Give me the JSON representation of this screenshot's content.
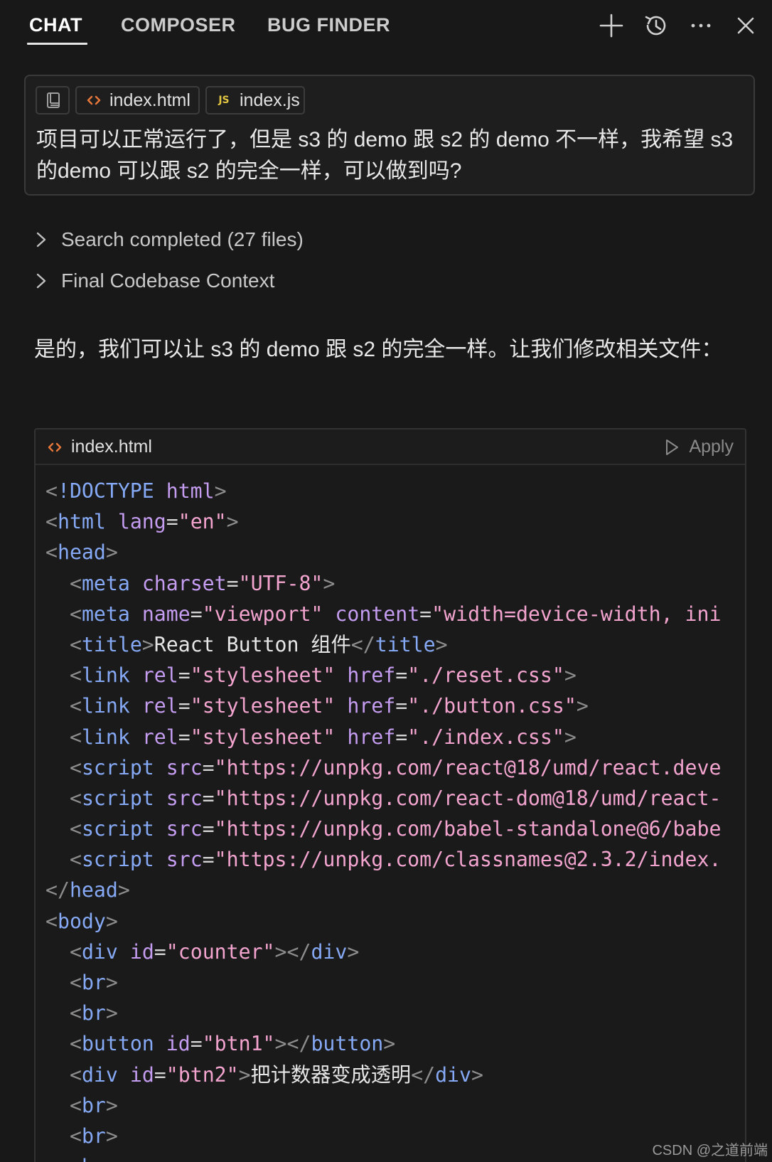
{
  "tabs": [
    {
      "label": "CHAT",
      "active": true
    },
    {
      "label": "COMPOSER",
      "active": false
    },
    {
      "label": "BUG FINDER",
      "active": false
    }
  ],
  "toolbar_icons": [
    "plus-icon",
    "history-icon",
    "more-icon",
    "close-icon"
  ],
  "message": {
    "chips": [
      {
        "icon": "book-icon",
        "label": ""
      },
      {
        "icon": "html-file-icon",
        "label": "index.html"
      },
      {
        "icon": "js-file-icon",
        "label": "index.js",
        "badge": "JS"
      }
    ],
    "text": "项目可以正常运行了，但是 s3 的 demo 跟 s2 的 demo 不一样，我希望 s3 的demo 可以跟 s2 的完全一样，可以做到吗?"
  },
  "collapsibles": [
    {
      "label": "Search completed (27 files)"
    },
    {
      "label": "Final Codebase Context"
    }
  ],
  "answer": "是的，我们可以让 s3 的 demo 跟 s2 的完全一样。让我们修改相关文件：",
  "code_block": {
    "filename": "index.html",
    "apply_label": "Apply",
    "lines": [
      [
        {
          "t": "p",
          "v": "<"
        },
        {
          "t": "tag",
          "v": "!DOCTYPE"
        },
        {
          "t": "eq",
          "v": " "
        },
        {
          "t": "attr",
          "v": "html"
        },
        {
          "t": "p",
          "v": ">"
        }
      ],
      [
        {
          "t": "p",
          "v": "<"
        },
        {
          "t": "tag",
          "v": "html"
        },
        {
          "t": "eq",
          "v": " "
        },
        {
          "t": "attr",
          "v": "lang"
        },
        {
          "t": "eq",
          "v": "="
        },
        {
          "t": "str",
          "v": "\"en\""
        },
        {
          "t": "p",
          "v": ">"
        }
      ],
      [
        {
          "t": "p",
          "v": "<"
        },
        {
          "t": "tag",
          "v": "head"
        },
        {
          "t": "p",
          "v": ">"
        }
      ],
      [
        {
          "t": "eq",
          "v": "  "
        },
        {
          "t": "p",
          "v": "<"
        },
        {
          "t": "tag",
          "v": "meta"
        },
        {
          "t": "eq",
          "v": " "
        },
        {
          "t": "attr",
          "v": "charset"
        },
        {
          "t": "eq",
          "v": "="
        },
        {
          "t": "str",
          "v": "\"UTF-8\""
        },
        {
          "t": "p",
          "v": ">"
        }
      ],
      [
        {
          "t": "eq",
          "v": "  "
        },
        {
          "t": "p",
          "v": "<"
        },
        {
          "t": "tag",
          "v": "meta"
        },
        {
          "t": "eq",
          "v": " "
        },
        {
          "t": "attr",
          "v": "name"
        },
        {
          "t": "eq",
          "v": "="
        },
        {
          "t": "str",
          "v": "\"viewport\""
        },
        {
          "t": "eq",
          "v": " "
        },
        {
          "t": "attr",
          "v": "content"
        },
        {
          "t": "eq",
          "v": "="
        },
        {
          "t": "str",
          "v": "\"width=device-width, ini"
        }
      ],
      [
        {
          "t": "eq",
          "v": "  "
        },
        {
          "t": "p",
          "v": "<"
        },
        {
          "t": "tag",
          "v": "title"
        },
        {
          "t": "p",
          "v": ">"
        },
        {
          "t": "txt",
          "v": "React Button 组件"
        },
        {
          "t": "p",
          "v": "</"
        },
        {
          "t": "tag",
          "v": "title"
        },
        {
          "t": "p",
          "v": ">"
        }
      ],
      [
        {
          "t": "eq",
          "v": "  "
        },
        {
          "t": "p",
          "v": "<"
        },
        {
          "t": "tag",
          "v": "link"
        },
        {
          "t": "eq",
          "v": " "
        },
        {
          "t": "attr",
          "v": "rel"
        },
        {
          "t": "eq",
          "v": "="
        },
        {
          "t": "str",
          "v": "\"stylesheet\""
        },
        {
          "t": "eq",
          "v": " "
        },
        {
          "t": "attr",
          "v": "href"
        },
        {
          "t": "eq",
          "v": "="
        },
        {
          "t": "str",
          "v": "\"./reset.css\""
        },
        {
          "t": "p",
          "v": ">"
        }
      ],
      [
        {
          "t": "eq",
          "v": "  "
        },
        {
          "t": "p",
          "v": "<"
        },
        {
          "t": "tag",
          "v": "link"
        },
        {
          "t": "eq",
          "v": " "
        },
        {
          "t": "attr",
          "v": "rel"
        },
        {
          "t": "eq",
          "v": "="
        },
        {
          "t": "str",
          "v": "\"stylesheet\""
        },
        {
          "t": "eq",
          "v": " "
        },
        {
          "t": "attr",
          "v": "href"
        },
        {
          "t": "eq",
          "v": "="
        },
        {
          "t": "str",
          "v": "\"./button.css\""
        },
        {
          "t": "p",
          "v": ">"
        }
      ],
      [
        {
          "t": "eq",
          "v": "  "
        },
        {
          "t": "p",
          "v": "<"
        },
        {
          "t": "tag",
          "v": "link"
        },
        {
          "t": "eq",
          "v": " "
        },
        {
          "t": "attr",
          "v": "rel"
        },
        {
          "t": "eq",
          "v": "="
        },
        {
          "t": "str",
          "v": "\"stylesheet\""
        },
        {
          "t": "eq",
          "v": " "
        },
        {
          "t": "attr",
          "v": "href"
        },
        {
          "t": "eq",
          "v": "="
        },
        {
          "t": "str",
          "v": "\"./index.css\""
        },
        {
          "t": "p",
          "v": ">"
        }
      ],
      [
        {
          "t": "eq",
          "v": "  "
        },
        {
          "t": "p",
          "v": "<"
        },
        {
          "t": "tag",
          "v": "script"
        },
        {
          "t": "eq",
          "v": " "
        },
        {
          "t": "attr",
          "v": "src"
        },
        {
          "t": "eq",
          "v": "="
        },
        {
          "t": "str",
          "v": "\"https://unpkg.com/react@18/umd/react.deve"
        }
      ],
      [
        {
          "t": "eq",
          "v": "  "
        },
        {
          "t": "p",
          "v": "<"
        },
        {
          "t": "tag",
          "v": "script"
        },
        {
          "t": "eq",
          "v": " "
        },
        {
          "t": "attr",
          "v": "src"
        },
        {
          "t": "eq",
          "v": "="
        },
        {
          "t": "str",
          "v": "\"https://unpkg.com/react-dom@18/umd/react-"
        }
      ],
      [
        {
          "t": "eq",
          "v": "  "
        },
        {
          "t": "p",
          "v": "<"
        },
        {
          "t": "tag",
          "v": "script"
        },
        {
          "t": "eq",
          "v": " "
        },
        {
          "t": "attr",
          "v": "src"
        },
        {
          "t": "eq",
          "v": "="
        },
        {
          "t": "str",
          "v": "\"https://unpkg.com/babel-standalone@6/babe"
        }
      ],
      [
        {
          "t": "eq",
          "v": "  "
        },
        {
          "t": "p",
          "v": "<"
        },
        {
          "t": "tag",
          "v": "script"
        },
        {
          "t": "eq",
          "v": " "
        },
        {
          "t": "attr",
          "v": "src"
        },
        {
          "t": "eq",
          "v": "="
        },
        {
          "t": "str",
          "v": "\"https://unpkg.com/classnames@2.3.2/index."
        }
      ],
      [
        {
          "t": "p",
          "v": "</"
        },
        {
          "t": "tag",
          "v": "head"
        },
        {
          "t": "p",
          "v": ">"
        }
      ],
      [
        {
          "t": "p",
          "v": "<"
        },
        {
          "t": "tag",
          "v": "body"
        },
        {
          "t": "p",
          "v": ">"
        }
      ],
      [
        {
          "t": "eq",
          "v": "  "
        },
        {
          "t": "p",
          "v": "<"
        },
        {
          "t": "tag",
          "v": "div"
        },
        {
          "t": "eq",
          "v": " "
        },
        {
          "t": "attr",
          "v": "id"
        },
        {
          "t": "eq",
          "v": "="
        },
        {
          "t": "str",
          "v": "\"counter\""
        },
        {
          "t": "p",
          "v": "></"
        },
        {
          "t": "tag",
          "v": "div"
        },
        {
          "t": "p",
          "v": ">"
        }
      ],
      [
        {
          "t": "eq",
          "v": "  "
        },
        {
          "t": "p",
          "v": "<"
        },
        {
          "t": "tag",
          "v": "br"
        },
        {
          "t": "p",
          "v": ">"
        }
      ],
      [
        {
          "t": "eq",
          "v": "  "
        },
        {
          "t": "p",
          "v": "<"
        },
        {
          "t": "tag",
          "v": "br"
        },
        {
          "t": "p",
          "v": ">"
        }
      ],
      [
        {
          "t": "eq",
          "v": "  "
        },
        {
          "t": "p",
          "v": "<"
        },
        {
          "t": "tag",
          "v": "button"
        },
        {
          "t": "eq",
          "v": " "
        },
        {
          "t": "attr",
          "v": "id"
        },
        {
          "t": "eq",
          "v": "="
        },
        {
          "t": "str",
          "v": "\"btn1\""
        },
        {
          "t": "p",
          "v": "></"
        },
        {
          "t": "tag",
          "v": "button"
        },
        {
          "t": "p",
          "v": ">"
        }
      ],
      [
        {
          "t": "eq",
          "v": "  "
        },
        {
          "t": "p",
          "v": "<"
        },
        {
          "t": "tag",
          "v": "div"
        },
        {
          "t": "eq",
          "v": " "
        },
        {
          "t": "attr",
          "v": "id"
        },
        {
          "t": "eq",
          "v": "="
        },
        {
          "t": "str",
          "v": "\"btn2\""
        },
        {
          "t": "p",
          "v": ">"
        },
        {
          "t": "txt",
          "v": "把计数器变成透明"
        },
        {
          "t": "p",
          "v": "</"
        },
        {
          "t": "tag",
          "v": "div"
        },
        {
          "t": "p",
          "v": ">"
        }
      ],
      [
        {
          "t": "eq",
          "v": "  "
        },
        {
          "t": "p",
          "v": "<"
        },
        {
          "t": "tag",
          "v": "br"
        },
        {
          "t": "p",
          "v": ">"
        }
      ],
      [
        {
          "t": "eq",
          "v": "  "
        },
        {
          "t": "p",
          "v": "<"
        },
        {
          "t": "tag",
          "v": "br"
        },
        {
          "t": "p",
          "v": ">"
        }
      ],
      [
        {
          "t": "eq",
          "v": "  "
        },
        {
          "t": "p",
          "v": "<"
        },
        {
          "t": "tag",
          "v": "br"
        },
        {
          "t": "p",
          "v": ">"
        }
      ]
    ]
  },
  "watermark": "CSDN @之道前端",
  "colors": {
    "background": "#181818",
    "tag": "#86a9f5",
    "attribute": "#c49cf0",
    "string": "#f2a4cf",
    "html_icon": "#e8773a",
    "js_icon": "#e2c541"
  }
}
